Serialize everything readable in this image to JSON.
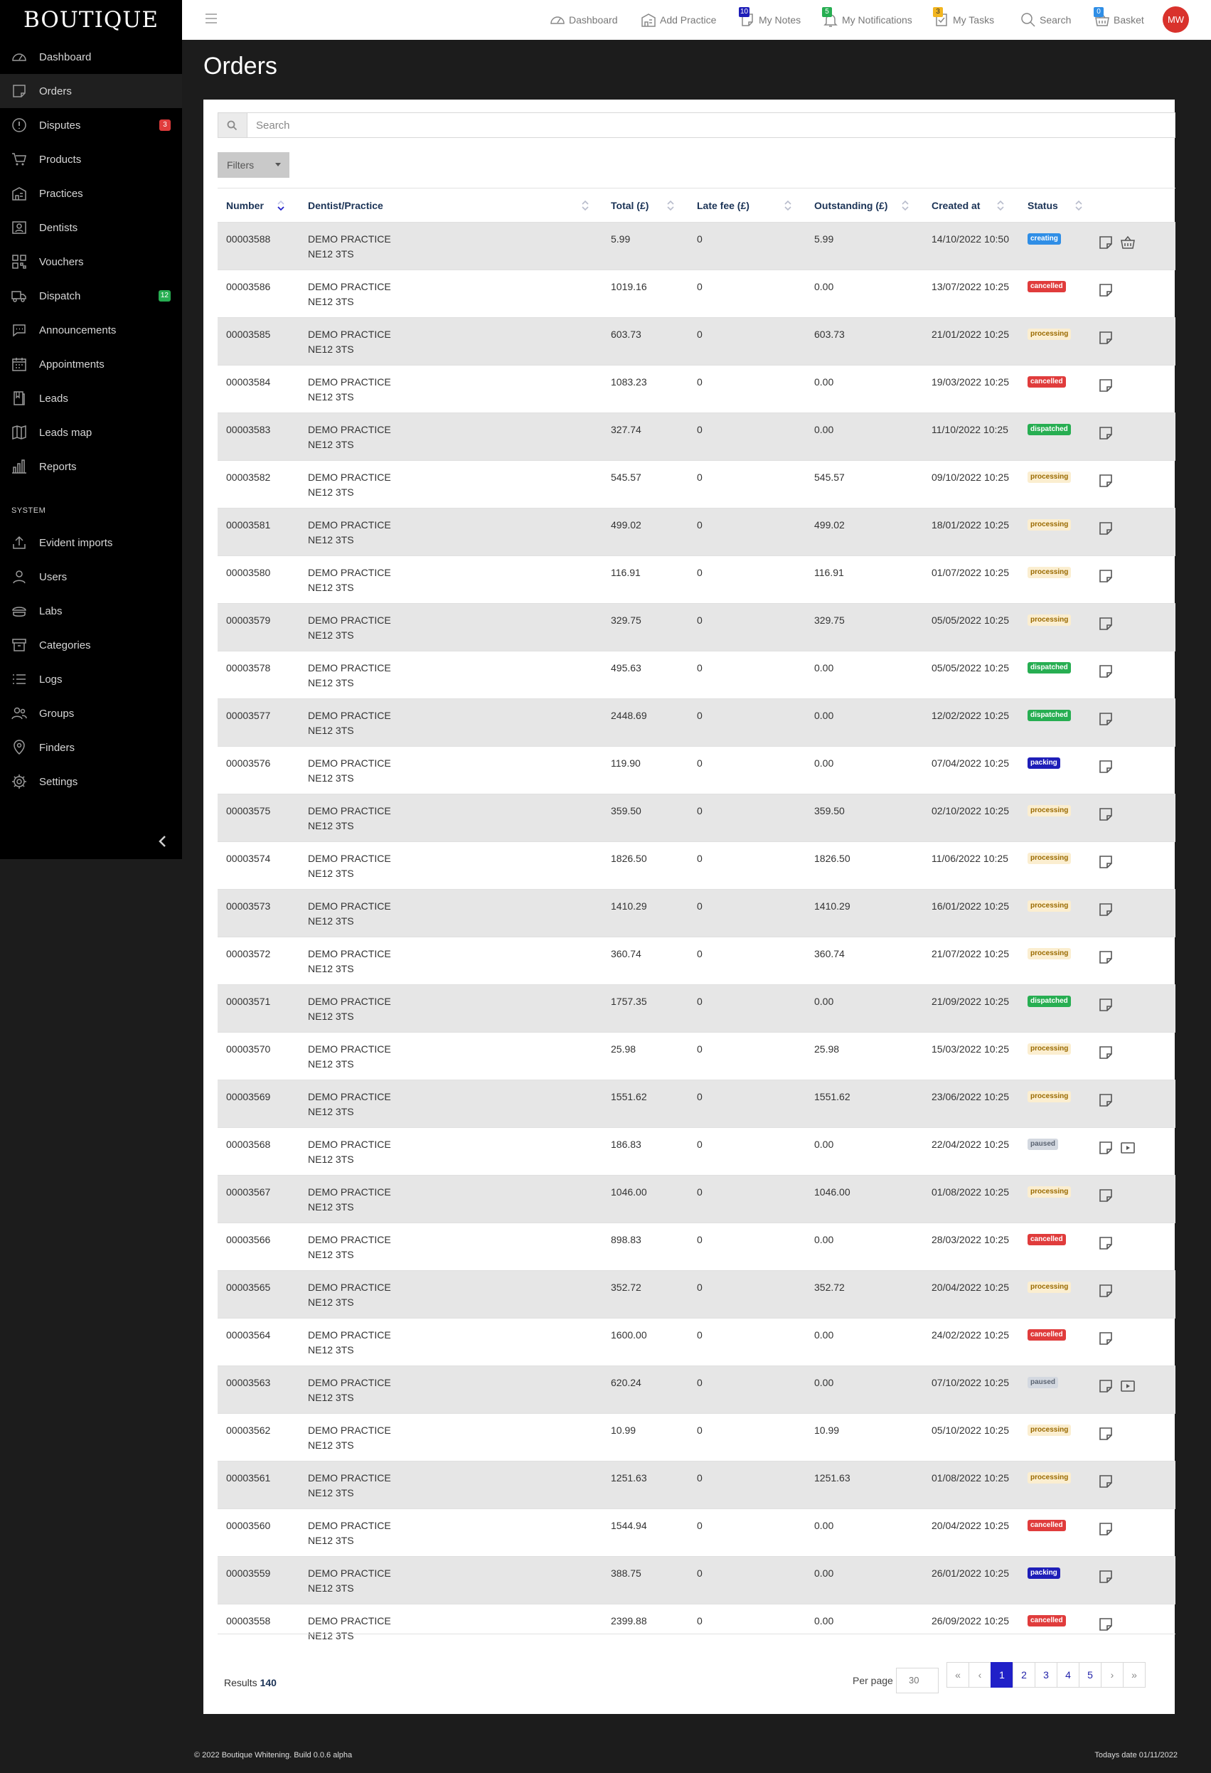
{
  "brand": "BOUTIQUE",
  "sidebar": {
    "items": [
      {
        "label": "Dashboard",
        "icon": "gauge-icon"
      },
      {
        "label": "Orders",
        "icon": "orders-icon"
      },
      {
        "label": "Disputes",
        "icon": "alert-icon",
        "badge": "3"
      },
      {
        "label": "Products",
        "icon": "cart-icon"
      },
      {
        "label": "Practices",
        "icon": "building-icon"
      },
      {
        "label": "Dentists",
        "icon": "person-card-icon"
      },
      {
        "label": "Vouchers",
        "icon": "qr-icon"
      },
      {
        "label": "Dispatch",
        "icon": "truck-icon",
        "badge": "12"
      },
      {
        "label": "Announcements",
        "icon": "chat-icon"
      },
      {
        "label": "Appointments",
        "icon": "calendar-icon"
      },
      {
        "label": "Leads",
        "icon": "book-icon"
      },
      {
        "label": "Leads map",
        "icon": "map-icon"
      },
      {
        "label": "Reports",
        "icon": "bars-icon"
      }
    ],
    "system_title": "SYSTEM",
    "system_items": [
      {
        "label": "Evident imports",
        "icon": "upload-icon"
      },
      {
        "label": "Users",
        "icon": "user-icon"
      },
      {
        "label": "Labs",
        "icon": "lab-icon"
      },
      {
        "label": "Categories",
        "icon": "archive-icon"
      },
      {
        "label": "Logs",
        "icon": "list-icon"
      },
      {
        "label": "Groups",
        "icon": "group-icon"
      },
      {
        "label": "Finders",
        "icon": "pin-icon"
      },
      {
        "label": "Settings",
        "icon": "gear-icon"
      }
    ]
  },
  "topbar": {
    "dashboard": "Dashboard",
    "add_practice": "Add Practice",
    "notes": "My Notes",
    "notes_badge": "10",
    "notifications": "My Notifications",
    "notifications_badge": "5",
    "tasks": "My Tasks",
    "tasks_badge": "3",
    "search": "Search",
    "basket": "Basket",
    "basket_badge": "0",
    "avatar": "MW"
  },
  "page": {
    "title": "Orders",
    "search_placeholder": "Search",
    "filters": "Filters"
  },
  "table": {
    "headers": {
      "number": "Number",
      "dentist": "Dentist/Practice",
      "total": "Total (£)",
      "late_fee": "Late fee (£)",
      "outstanding": "Outstanding (£)",
      "created": "Created at",
      "status": "Status"
    },
    "practice_name": "DEMO PRACTICE",
    "practice_postcode": "NE12 3TS",
    "rows": [
      {
        "number": "00003588",
        "total": "5.99",
        "late_fee": "0",
        "outstanding": "5.99",
        "created": "14/10/2022 10:50",
        "status": "creating",
        "actions": [
          "note",
          "basket"
        ]
      },
      {
        "number": "00003586",
        "total": "1019.16",
        "late_fee": "0",
        "outstanding": "0.00",
        "created": "13/07/2022 10:25",
        "status": "cancelled",
        "actions": [
          "note"
        ]
      },
      {
        "number": "00003585",
        "total": "603.73",
        "late_fee": "0",
        "outstanding": "603.73",
        "created": "21/01/2022 10:25",
        "status": "processing",
        "actions": [
          "note"
        ]
      },
      {
        "number": "00003584",
        "total": "1083.23",
        "late_fee": "0",
        "outstanding": "0.00",
        "created": "19/03/2022 10:25",
        "status": "cancelled",
        "actions": [
          "note"
        ]
      },
      {
        "number": "00003583",
        "total": "327.74",
        "late_fee": "0",
        "outstanding": "0.00",
        "created": "11/10/2022 10:25",
        "status": "dispatched",
        "actions": [
          "note"
        ]
      },
      {
        "number": "00003582",
        "total": "545.57",
        "late_fee": "0",
        "outstanding": "545.57",
        "created": "09/10/2022 10:25",
        "status": "processing",
        "actions": [
          "note"
        ]
      },
      {
        "number": "00003581",
        "total": "499.02",
        "late_fee": "0",
        "outstanding": "499.02",
        "created": "18/01/2022 10:25",
        "status": "processing",
        "actions": [
          "note"
        ]
      },
      {
        "number": "00003580",
        "total": "116.91",
        "late_fee": "0",
        "outstanding": "116.91",
        "created": "01/07/2022 10:25",
        "status": "processing",
        "actions": [
          "note"
        ]
      },
      {
        "number": "00003579",
        "total": "329.75",
        "late_fee": "0",
        "outstanding": "329.75",
        "created": "05/05/2022 10:25",
        "status": "processing",
        "actions": [
          "note"
        ]
      },
      {
        "number": "00003578",
        "total": "495.63",
        "late_fee": "0",
        "outstanding": "0.00",
        "created": "05/05/2022 10:25",
        "status": "dispatched",
        "actions": [
          "note"
        ]
      },
      {
        "number": "00003577",
        "total": "2448.69",
        "late_fee": "0",
        "outstanding": "0.00",
        "created": "12/02/2022 10:25",
        "status": "dispatched",
        "actions": [
          "note"
        ]
      },
      {
        "number": "00003576",
        "total": "119.90",
        "late_fee": "0",
        "outstanding": "0.00",
        "created": "07/04/2022 10:25",
        "status": "packing",
        "actions": [
          "note"
        ]
      },
      {
        "number": "00003575",
        "total": "359.50",
        "late_fee": "0",
        "outstanding": "359.50",
        "created": "02/10/2022 10:25",
        "status": "processing",
        "actions": [
          "note"
        ]
      },
      {
        "number": "00003574",
        "total": "1826.50",
        "late_fee": "0",
        "outstanding": "1826.50",
        "created": "11/06/2022 10:25",
        "status": "processing",
        "actions": [
          "note"
        ]
      },
      {
        "number": "00003573",
        "total": "1410.29",
        "late_fee": "0",
        "outstanding": "1410.29",
        "created": "16/01/2022 10:25",
        "status": "processing",
        "actions": [
          "note"
        ]
      },
      {
        "number": "00003572",
        "total": "360.74",
        "late_fee": "0",
        "outstanding": "360.74",
        "created": "21/07/2022 10:25",
        "status": "processing",
        "actions": [
          "note"
        ]
      },
      {
        "number": "00003571",
        "total": "1757.35",
        "late_fee": "0",
        "outstanding": "0.00",
        "created": "21/09/2022 10:25",
        "status": "dispatched",
        "actions": [
          "note"
        ]
      },
      {
        "number": "00003570",
        "total": "25.98",
        "late_fee": "0",
        "outstanding": "25.98",
        "created": "15/03/2022 10:25",
        "status": "processing",
        "actions": [
          "note"
        ]
      },
      {
        "number": "00003569",
        "total": "1551.62",
        "late_fee": "0",
        "outstanding": "1551.62",
        "created": "23/06/2022 10:25",
        "status": "processing",
        "actions": [
          "note"
        ]
      },
      {
        "number": "00003568",
        "total": "186.83",
        "late_fee": "0",
        "outstanding": "0.00",
        "created": "22/04/2022 10:25",
        "status": "paused",
        "actions": [
          "note",
          "play"
        ]
      },
      {
        "number": "00003567",
        "total": "1046.00",
        "late_fee": "0",
        "outstanding": "1046.00",
        "created": "01/08/2022 10:25",
        "status": "processing",
        "actions": [
          "note"
        ]
      },
      {
        "number": "00003566",
        "total": "898.83",
        "late_fee": "0",
        "outstanding": "0.00",
        "created": "28/03/2022 10:25",
        "status": "cancelled",
        "actions": [
          "note"
        ]
      },
      {
        "number": "00003565",
        "total": "352.72",
        "late_fee": "0",
        "outstanding": "352.72",
        "created": "20/04/2022 10:25",
        "status": "processing",
        "actions": [
          "note"
        ]
      },
      {
        "number": "00003564",
        "total": "1600.00",
        "late_fee": "0",
        "outstanding": "0.00",
        "created": "24/02/2022 10:25",
        "status": "cancelled",
        "actions": [
          "note"
        ]
      },
      {
        "number": "00003563",
        "total": "620.24",
        "late_fee": "0",
        "outstanding": "0.00",
        "created": "07/10/2022 10:25",
        "status": "paused",
        "actions": [
          "note",
          "play"
        ]
      },
      {
        "number": "00003562",
        "total": "10.99",
        "late_fee": "0",
        "outstanding": "10.99",
        "created": "05/10/2022 10:25",
        "status": "processing",
        "actions": [
          "note"
        ]
      },
      {
        "number": "00003561",
        "total": "1251.63",
        "late_fee": "0",
        "outstanding": "1251.63",
        "created": "01/08/2022 10:25",
        "status": "processing",
        "actions": [
          "note"
        ]
      },
      {
        "number": "00003560",
        "total": "1544.94",
        "late_fee": "0",
        "outstanding": "0.00",
        "created": "20/04/2022 10:25",
        "status": "cancelled",
        "actions": [
          "note"
        ]
      },
      {
        "number": "00003559",
        "total": "388.75",
        "late_fee": "0",
        "outstanding": "0.00",
        "created": "26/01/2022 10:25",
        "status": "packing",
        "actions": [
          "note"
        ]
      },
      {
        "number": "00003558",
        "total": "2399.88",
        "late_fee": "0",
        "outstanding": "0.00",
        "created": "26/09/2022 10:25",
        "status": "cancelled",
        "actions": [
          "note"
        ]
      }
    ]
  },
  "status_colors": {
    "creating": {
      "bg": "#2f8ee6",
      "fg": "#ffffff"
    },
    "cancelled": {
      "bg": "#e03c3c",
      "fg": "#ffffff"
    },
    "processing": {
      "bg": "#fbeed0",
      "fg": "#9a6a00"
    },
    "dispatched": {
      "bg": "#27ae52",
      "fg": "#ffffff"
    },
    "packing": {
      "bg": "#1e1eb8",
      "fg": "#ffffff"
    },
    "paused": {
      "bg": "#d3d8e0",
      "fg": "#5b6472"
    }
  },
  "pagination": {
    "results_label": "Results",
    "results_count": "140",
    "per_page_label": "Per page",
    "per_page_value": "30",
    "first": "«",
    "prev": "‹",
    "pages": [
      "1",
      "2",
      "3",
      "4",
      "5"
    ],
    "current": "1",
    "next": "›",
    "last": "»"
  },
  "footer": {
    "copyright": "© 2022 Boutique Whitening. Build 0.0.6 alpha",
    "today": "Todays date 01/11/2022"
  }
}
